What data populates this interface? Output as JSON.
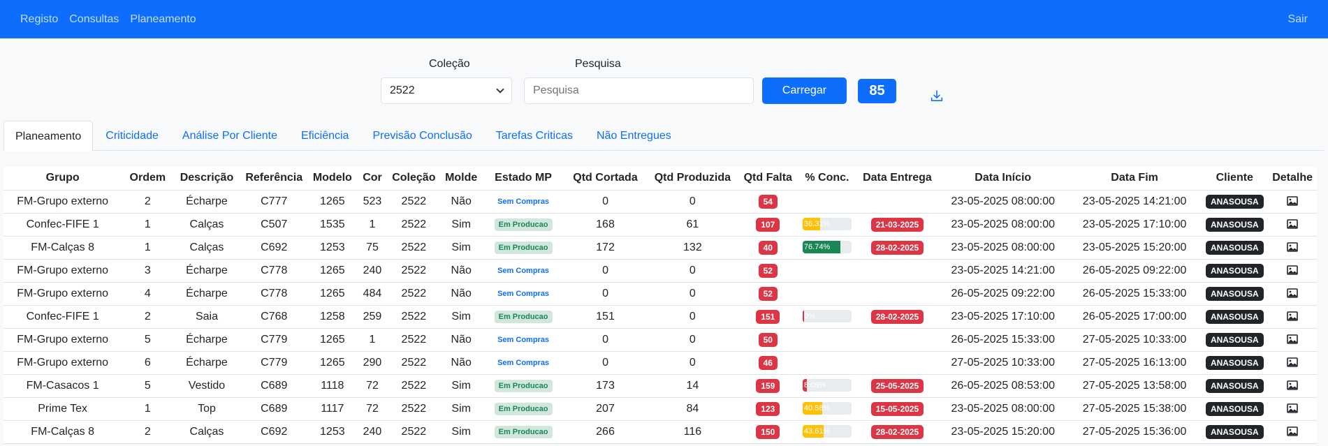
{
  "nav": {
    "links": [
      "Registo",
      "Consultas",
      "Planeamento"
    ],
    "logout": "Sair"
  },
  "filters": {
    "colecao_label": "Coleção",
    "colecao_value": "2522",
    "pesquisa_label": "Pesquisa",
    "pesquisa_placeholder": "Pesquisa",
    "load_button": "Carregar",
    "count": "85"
  },
  "tabs": [
    "Planeamento",
    "Criticidade",
    "Análise Por Cliente",
    "Eficiência",
    "Previsão Conclusão",
    "Tarefas Criticas",
    "Não Entregues"
  ],
  "table": {
    "headers": [
      "Grupo",
      "Ordem",
      "Descrição",
      "Referência",
      "Modelo",
      "Cor",
      "Coleção",
      "Molde",
      "Estado MP",
      "Qtd Cortada",
      "Qtd Produzida",
      "Qtd Falta",
      "% Conc.",
      "Data Entrega",
      "Data Início",
      "Data Fim",
      "Cliente",
      "Detalhe"
    ],
    "rows": [
      {
        "grupo": "FM-Grupo externo",
        "ordem": "2",
        "descricao": "Écharpe",
        "referencia": "C777",
        "modelo": "1265",
        "cor": "523",
        "colecao": "2522",
        "molde": "Não",
        "estado": "Sem Compras",
        "cortada": "0",
        "produzida": "0",
        "falta": "54",
        "conc_label": "",
        "conc_value": null,
        "conc_color": "",
        "entrega": "",
        "inicio": "23-05-2025 08:00:00",
        "fim": "23-05-2025 14:21:00",
        "cliente": "ANASOUSA"
      },
      {
        "grupo": "Confec-FIFE 1",
        "ordem": "1",
        "descricao": "Calças",
        "referencia": "C507",
        "modelo": "1535",
        "cor": "1",
        "colecao": "2522",
        "molde": "Sim",
        "estado": "Em Producao",
        "cortada": "168",
        "produzida": "61",
        "falta": "107",
        "conc_label": "36.31%",
        "conc_value": 36.31,
        "conc_color": "#ffc107",
        "entrega": "21-03-2025",
        "inicio": "23-05-2025 08:00:00",
        "fim": "23-05-2025 17:10:00",
        "cliente": "ANASOUSA"
      },
      {
        "grupo": "FM-Calças 8",
        "ordem": "1",
        "descricao": "Calças",
        "referencia": "C692",
        "modelo": "1253",
        "cor": "75",
        "colecao": "2522",
        "molde": "Sim",
        "estado": "Em Producao",
        "cortada": "172",
        "produzida": "132",
        "falta": "40",
        "conc_label": "76.74%",
        "conc_value": 76.74,
        "conc_color": "#198754",
        "entrega": "28-02-2025",
        "inicio": "23-05-2025 08:00:00",
        "fim": "23-05-2025 15:20:00",
        "cliente": "ANASOUSA"
      },
      {
        "grupo": "FM-Grupo externo",
        "ordem": "3",
        "descricao": "Écharpe",
        "referencia": "C778",
        "modelo": "1265",
        "cor": "240",
        "colecao": "2522",
        "molde": "Não",
        "estado": "Sem Compras",
        "cortada": "0",
        "produzida": "0",
        "falta": "52",
        "conc_label": "",
        "conc_value": null,
        "conc_color": "",
        "entrega": "",
        "inicio": "23-05-2025 14:21:00",
        "fim": "26-05-2025 09:22:00",
        "cliente": "ANASOUSA"
      },
      {
        "grupo": "FM-Grupo externo",
        "ordem": "4",
        "descricao": "Écharpe",
        "referencia": "C778",
        "modelo": "1265",
        "cor": "484",
        "colecao": "2522",
        "molde": "Não",
        "estado": "Sem Compras",
        "cortada": "0",
        "produzida": "0",
        "falta": "52",
        "conc_label": "",
        "conc_value": null,
        "conc_color": "",
        "entrega": "",
        "inicio": "26-05-2025 09:22:00",
        "fim": "26-05-2025 15:33:00",
        "cliente": "ANASOUSA"
      },
      {
        "grupo": "Confec-FIFE 1",
        "ordem": "2",
        "descricao": "Saia",
        "referencia": "C768",
        "modelo": "1258",
        "cor": "259",
        "colecao": "2522",
        "molde": "Sim",
        "estado": "Em Producao",
        "cortada": "151",
        "produzida": "0",
        "falta": "151",
        "conc_label": "0%",
        "conc_value": 0,
        "conc_color": "#dc3545",
        "entrega": "28-02-2025",
        "inicio": "23-05-2025 17:10:00",
        "fim": "26-05-2025 17:00:00",
        "cliente": "ANASOUSA"
      },
      {
        "grupo": "FM-Grupo externo",
        "ordem": "5",
        "descricao": "Écharpe",
        "referencia": "C779",
        "modelo": "1265",
        "cor": "1",
        "colecao": "2522",
        "molde": "Não",
        "estado": "Sem Compras",
        "cortada": "0",
        "produzida": "0",
        "falta": "50",
        "conc_label": "",
        "conc_value": null,
        "conc_color": "",
        "entrega": "",
        "inicio": "26-05-2025 15:33:00",
        "fim": "27-05-2025 10:33:00",
        "cliente": "ANASOUSA"
      },
      {
        "grupo": "FM-Grupo externo",
        "ordem": "6",
        "descricao": "Écharpe",
        "referencia": "C779",
        "modelo": "1265",
        "cor": "290",
        "colecao": "2522",
        "molde": "Não",
        "estado": "Sem Compras",
        "cortada": "0",
        "produzida": "0",
        "falta": "46",
        "conc_label": "",
        "conc_value": null,
        "conc_color": "",
        "entrega": "",
        "inicio": "27-05-2025 10:33:00",
        "fim": "27-05-2025 16:13:00",
        "cliente": "ANASOUSA"
      },
      {
        "grupo": "FM-Casacos 1",
        "ordem": "5",
        "descricao": "Vestido",
        "referencia": "C689",
        "modelo": "1118",
        "cor": "72",
        "colecao": "2522",
        "molde": "Sim",
        "estado": "Em Producao",
        "cortada": "173",
        "produzida": "14",
        "falta": "159",
        "conc_label": "8.09%",
        "conc_value": 8.09,
        "conc_color": "#dc3545",
        "entrega": "25-05-2025",
        "inicio": "26-05-2025 08:53:00",
        "fim": "27-05-2025 13:58:00",
        "cliente": "ANASOUSA"
      },
      {
        "grupo": "Prime Tex",
        "ordem": "1",
        "descricao": "Top",
        "referencia": "C689",
        "modelo": "1117",
        "cor": "72",
        "colecao": "2522",
        "molde": "Sim",
        "estado": "Em Producao",
        "cortada": "207",
        "produzida": "84",
        "falta": "123",
        "conc_label": "40.58%",
        "conc_value": 40.58,
        "conc_color": "#ffc107",
        "entrega": "15-05-2025",
        "inicio": "23-05-2025 08:00:00",
        "fim": "27-05-2025 15:38:00",
        "cliente": "ANASOUSA"
      },
      {
        "grupo": "FM-Calças 8",
        "ordem": "2",
        "descricao": "Calças",
        "referencia": "C692",
        "modelo": "1253",
        "cor": "240",
        "colecao": "2522",
        "molde": "Sim",
        "estado": "Em Producao",
        "cortada": "266",
        "produzida": "116",
        "falta": "150",
        "conc_label": "43.61%",
        "conc_value": 43.61,
        "conc_color": "#ffc107",
        "entrega": "28-02-2025",
        "inicio": "23-05-2025 15:20:00",
        "fim": "27-05-2025 15:36:00",
        "cliente": "ANASOUSA"
      }
    ]
  }
}
